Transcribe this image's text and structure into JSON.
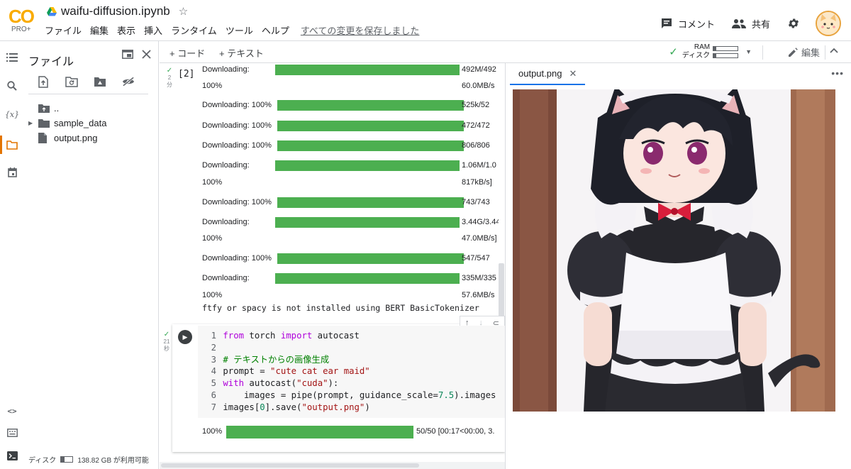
{
  "header": {
    "logo_text": "CO",
    "logo_sub": "PRO+",
    "notebook_title": "waifu-diffusion.ipynb",
    "menu": [
      "ファイル",
      "編集",
      "表示",
      "挿入",
      "ランタイム",
      "ツール",
      "ヘルプ"
    ],
    "saved_status": "すべての変更を保存しました",
    "comment_label": "コメント",
    "share_label": "共有"
  },
  "sidebar": {
    "panel_title": "ファイル",
    "tree": [
      {
        "name": ".."
      },
      {
        "name": "sample_data"
      },
      {
        "name": "output.png"
      }
    ],
    "disk_label": "ディスク",
    "disk_free": "138.82 GB が利用可能",
    "disk_usage_fraction": 0.3
  },
  "toolbar": {
    "add_code": "+ コード",
    "add_text": "+ テキスト",
    "ram_label": "RAM",
    "disk_label": "ディスク",
    "ram_usage_fraction": 0.12,
    "disk_usage_fraction": 0.12,
    "edit_label": "編集"
  },
  "cell1": {
    "exec_count": "[2]",
    "gutter_time": "2\n分",
    "outputs": [
      {
        "label": "Downloading:",
        "size": "492M/492",
        "bar": true
      },
      {
        "label": "100%",
        "size": "60.0MB/s",
        "bar": false
      },
      {
        "label": "Downloading: 100%",
        "size": "525k/52",
        "bar": true
      },
      {
        "label": "Downloading: 100%",
        "size": "472/472",
        "bar": true
      },
      {
        "label": "Downloading: 100%",
        "size": "806/806",
        "bar": true
      },
      {
        "label": "Downloading:",
        "size": "1.06M/1.0",
        "bar": true
      },
      {
        "label": "100%",
        "size": "817kB/s]",
        "bar": false
      },
      {
        "label": "Downloading: 100%",
        "size": "743/743",
        "bar": true
      },
      {
        "label": "Downloading:",
        "size": "3.44G/3.44",
        "bar": true
      },
      {
        "label": "100%",
        "size": "47.0MB/s]",
        "bar": false
      },
      {
        "label": "Downloading: 100%",
        "size": "547/547",
        "bar": true
      },
      {
        "label": "Downloading:",
        "size": "335M/335",
        "bar": true
      },
      {
        "label": "100%",
        "size": "57.6MB/s",
        "bar": false
      }
    ],
    "warning": "ftfy or spacy is not installed using BERT BasicTokenizer"
  },
  "cell2": {
    "gutter_time": "21\n秒",
    "code_lines": [
      "1",
      "2",
      "3",
      "4",
      "5",
      "6",
      "7"
    ],
    "progress_label": "100%",
    "progress_fraction": 1.0,
    "progress_text": "50/50 [00:17<00:00, 3."
  },
  "viewer": {
    "tab_label": "output.png"
  },
  "colors": {
    "accent_orange": "#e37400",
    "logo_yellow": "#f9ab00",
    "progress_green": "#4caf50",
    "tab_blue": "#1a73e8",
    "check_green": "#34a853"
  }
}
